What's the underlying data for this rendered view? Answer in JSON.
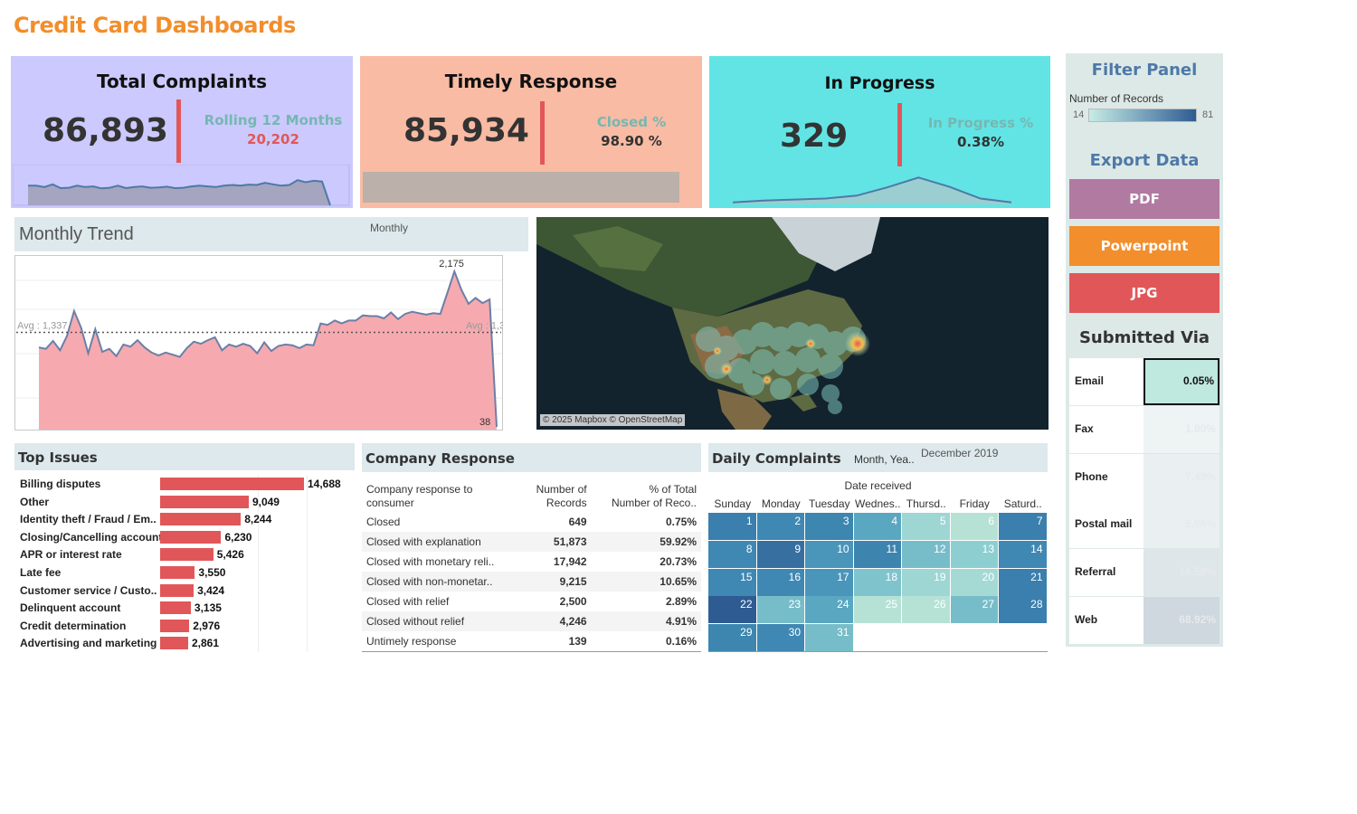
{
  "title": "Credit Card Dashboards",
  "kpis": {
    "total": {
      "title": "Total Complaints",
      "value": "86,893",
      "sub_label": "Rolling 12 Months",
      "sub_value": "20,202",
      "spark": [
        0.62,
        0.62,
        0.58,
        0.66,
        0.55,
        0.56,
        0.62,
        0.58,
        0.6,
        0.54,
        0.56,
        0.62,
        0.55,
        0.58,
        0.6,
        0.56,
        0.57,
        0.59,
        0.55,
        0.56,
        0.6,
        0.62,
        0.6,
        0.58,
        0.62,
        0.64,
        0.62,
        0.65,
        0.64,
        0.7,
        0.66,
        0.62,
        0.64,
        0.78,
        0.72,
        0.76,
        0.74,
        0.05
      ]
    },
    "timely": {
      "title": "Timely Response",
      "value": "85,934",
      "sub_label": "Closed %",
      "sub_value": "98.90 %"
    },
    "progress": {
      "title": "In Progress",
      "value": "329",
      "sub_label": "In Progress %",
      "sub_value": "0.38%",
      "spark": [
        0.04,
        0.08,
        0.1,
        0.12,
        0.18,
        0.35,
        0.55,
        0.36,
        0.12,
        0.04
      ]
    }
  },
  "filter_panel": {
    "title": "Filter Panel",
    "legend_title": "Number of Records",
    "legend_min": "14",
    "legend_max": "81",
    "export_title": "Export Data",
    "export_buttons": [
      {
        "label": "PDF",
        "color": "#b07aa1"
      },
      {
        "label": "Powerpoint",
        "color": "#f28e2b"
      },
      {
        "label": "JPG",
        "color": "#e15759"
      }
    ],
    "submitted_title": "Submitted Via",
    "submitted": [
      {
        "label": "Email",
        "value": "0.05%"
      },
      {
        "label": "Fax",
        "value": "1.00%"
      },
      {
        "label": "Phone",
        "value": "7.48%"
      },
      {
        "label": "Postal mail",
        "value": "5.96%"
      },
      {
        "label": "Referral",
        "value": "16.58%"
      },
      {
        "label": "Web",
        "value": "68.92%"
      }
    ]
  },
  "monthly_trend": {
    "title": "Monthly Trend",
    "control_label": "Monthly",
    "avg_label_left": "Avg : 1,337",
    "avg_label_right": "Avg : 1,337",
    "max_label": "2,175",
    "min_label": "38"
  },
  "chart_data": {
    "type": "area",
    "title": "Monthly Trend",
    "avg": 1337,
    "ylim": [
      0,
      2400
    ],
    "values": [
      1130,
      1110,
      1220,
      1090,
      1290,
      1630,
      1400,
      1050,
      1380,
      1070,
      1110,
      1010,
      1170,
      1140,
      1230,
      1130,
      1060,
      1020,
      1060,
      1030,
      1000,
      1120,
      1210,
      1180,
      1230,
      1270,
      1090,
      1170,
      1140,
      1180,
      1150,
      1050,
      1200,
      1080,
      1150,
      1170,
      1160,
      1120,
      1170,
      1160,
      1460,
      1440,
      1500,
      1460,
      1500,
      1500,
      1570,
      1560,
      1560,
      1530,
      1610,
      1520,
      1590,
      1620,
      1600,
      1580,
      1600,
      1590,
      1880,
      2175,
      1920,
      1730,
      1810,
      1740,
      1790,
      38
    ]
  },
  "map": {
    "attribution": "© 2025 Mapbox © OpenStreetMap"
  },
  "top_issues": {
    "title": "Top Issues",
    "max": 14688,
    "items": [
      {
        "label": "Billing disputes",
        "value": 14688,
        "display": "14,688"
      },
      {
        "label": "Other",
        "value": 9049,
        "display": "9,049"
      },
      {
        "label": "Identity theft / Fraud / Em..",
        "value": 8244,
        "display": "8,244"
      },
      {
        "label": "Closing/Cancelling account",
        "value": 6230,
        "display": "6,230"
      },
      {
        "label": "APR or interest rate",
        "value": 5426,
        "display": "5,426"
      },
      {
        "label": "Late fee",
        "value": 3550,
        "display": "3,550"
      },
      {
        "label": "Customer service / Custo..",
        "value": 3424,
        "display": "3,424"
      },
      {
        "label": "Delinquent account",
        "value": 3135,
        "display": "3,135"
      },
      {
        "label": "Credit determination",
        "value": 2976,
        "display": "2,976"
      },
      {
        "label": "Advertising and marketing",
        "value": 2861,
        "display": "2,861"
      }
    ]
  },
  "company_response": {
    "title": "Company Response",
    "col1": [
      "Company response to",
      "consumer"
    ],
    "col2": [
      "Number of",
      "Records"
    ],
    "col3": [
      "% of Total",
      "Number of Reco.."
    ],
    "rows": [
      {
        "label": "Closed",
        "count": "649",
        "pct": "0.75%"
      },
      {
        "label": "Closed with explanation",
        "count": "51,873",
        "pct": "59.92%"
      },
      {
        "label": "Closed with monetary reli..",
        "count": "17,942",
        "pct": "20.73%"
      },
      {
        "label": "Closed with non-monetar..",
        "count": "9,215",
        "pct": "10.65%"
      },
      {
        "label": "Closed with relief",
        "count": "2,500",
        "pct": "2.89%"
      },
      {
        "label": "Closed without relief",
        "count": "4,246",
        "pct": "4.91%"
      },
      {
        "label": "Untimely response",
        "count": "139",
        "pct": "0.16%"
      }
    ]
  },
  "daily": {
    "title": "Daily Complaints",
    "filter_label": "Month, Yea..",
    "filter_value": "December 2019",
    "axis_label": "Date received",
    "weekdays": [
      "Sunday",
      "Monday",
      "Tuesday",
      "Wednes..",
      "Thursd..",
      "Friday",
      "Saturd.."
    ],
    "colors": [
      "#3a7fad",
      "#3f88b3",
      "#3c86b0",
      "#5aa7c1",
      "#9ed6d3",
      "#b6e2d6",
      "#3a7fad",
      "#3f88b3",
      "#366fa0",
      "#4a95ba",
      "#3d84ae",
      "#77bdc9",
      "#8dcfd0",
      "#3f88b3",
      "#3f88b3",
      "#3f88b3",
      "#4a95ba",
      "#7fc4cd",
      "#9ed6d3",
      "#a5dad4",
      "#3a7fad",
      "#2e5c92",
      "#77bdc9",
      "#5aa7c1",
      "#b6e2d6",
      "#b6e2d6",
      "#77bdc9",
      "#3a7fad",
      "#3c86b0",
      "#3f88b3",
      "#77bdc9"
    ]
  }
}
